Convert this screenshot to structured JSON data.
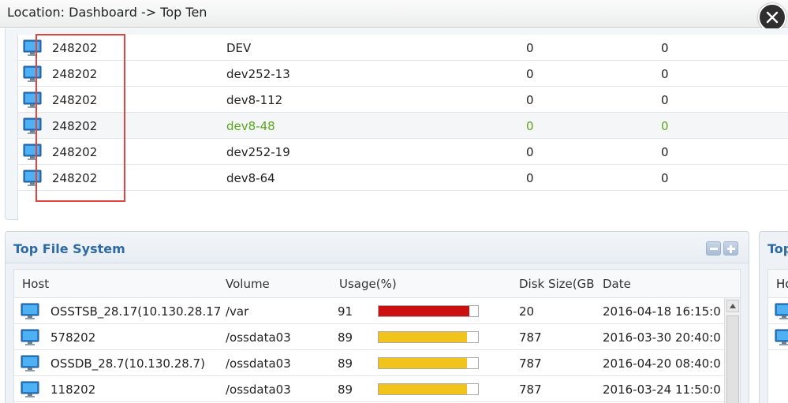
{
  "location": {
    "text": "Location: Dashboard -> Top Ten"
  },
  "top_table": {
    "rows": [
      {
        "id": "248202",
        "name": "DEV",
        "v1": "0",
        "v2": "0"
      },
      {
        "id": "248202",
        "name": "dev252-13",
        "v1": "0",
        "v2": "0"
      },
      {
        "id": "248202",
        "name": "dev8-112",
        "v1": "0",
        "v2": "0"
      },
      {
        "id": "248202",
        "name": "dev8-48",
        "v1": "0",
        "v2": "0",
        "highlighted": true
      },
      {
        "id": "248202",
        "name": "dev252-19",
        "v1": "0",
        "v2": "0"
      },
      {
        "id": "248202",
        "name": "dev8-64",
        "v1": "0",
        "v2": "0"
      }
    ]
  },
  "file_system": {
    "title": "Top File System",
    "columns": {
      "host": "Host",
      "volume": "Volume",
      "usage": "Usage(%)",
      "disk_size": "Disk Size(GB",
      "date": "Date"
    },
    "rows": [
      {
        "host": "OSSTSB_28.17(10.130.28.17",
        "volume": "/var",
        "usage": "91",
        "usage_pct": 91,
        "bar_color": "#cc1010",
        "disk_size": "20",
        "date": "2016-04-18 16:15:0"
      },
      {
        "host": "578202",
        "volume": "/ossdata03",
        "usage": "89",
        "usage_pct": 89,
        "bar_color": "#f2c31a",
        "disk_size": "787",
        "date": "2016-03-30 20:40:0"
      },
      {
        "host": "OSSDB_28.7(10.130.28.7)",
        "volume": "/ossdata03",
        "usage": "89",
        "usage_pct": 89,
        "bar_color": "#f2c31a",
        "disk_size": "787",
        "date": "2016-04-20 08:40:0"
      },
      {
        "host": "118202",
        "volume": "/ossdata03",
        "usage": "89",
        "usage_pct": 89,
        "bar_color": "#f2c31a",
        "disk_size": "787",
        "date": "2016-03-24 11:50:0"
      }
    ]
  },
  "side_panel": {
    "title": "Top",
    "header": "Ho"
  },
  "icons": {
    "host": "monitor-icon",
    "close": "close-icon",
    "minimize": "minus-icon",
    "maximize": "plus-icon"
  }
}
